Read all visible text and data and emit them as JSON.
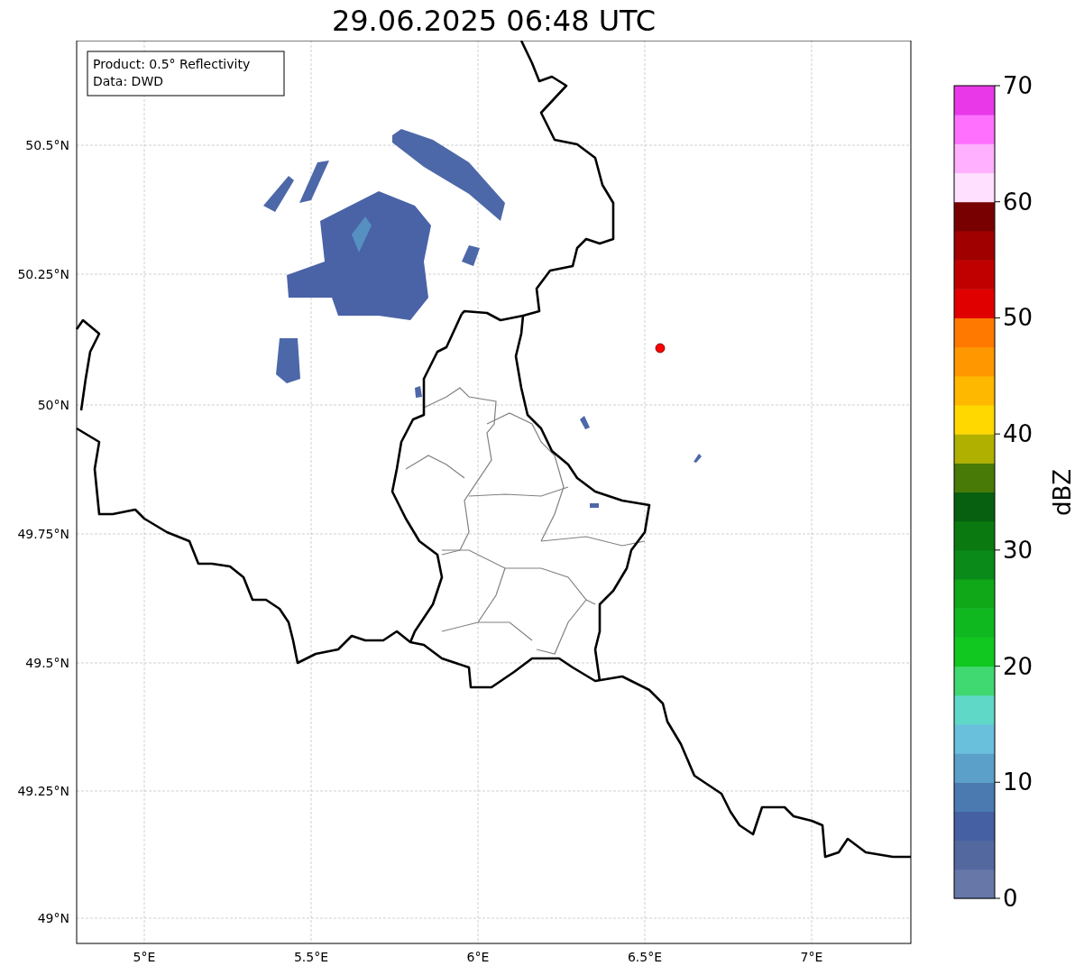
{
  "title": "29.06.2025 06:48 UTC",
  "map": {
    "info_lines": [
      "Product: 0.5° Reflectivity",
      "Data: DWD"
    ],
    "lat_labels": [
      "50.5°N",
      "50.25°N",
      "50°N",
      "49.75°N",
      "49.5°N",
      "49.25°N",
      "49°N"
    ],
    "lon_labels": [
      "5°E",
      "5.5°E",
      "6°E",
      "6.5°E",
      "7°E"
    ]
  },
  "colorbar": {
    "label": "dBZ",
    "ticks": [
      "70",
      "60",
      "50",
      "40",
      "30",
      "20",
      "10",
      "0"
    ],
    "bins": [
      {
        "color": "#6677a8"
      },
      {
        "color": "#5468a0"
      },
      {
        "color": "#4560a3"
      },
      {
        "color": "#4a7ab0"
      },
      {
        "color": "#5aa0c8"
      },
      {
        "color": "#68c0dc"
      },
      {
        "color": "#60d8c8"
      },
      {
        "color": "#40d870"
      },
      {
        "color": "#10c820"
      },
      {
        "color": "#10b820"
      },
      {
        "color": "#10a818"
      },
      {
        "color": "#0a8a18"
      },
      {
        "color": "#0a7a10"
      },
      {
        "color": "#066010"
      },
      {
        "color": "#487a08"
      },
      {
        "color": "#b0b000"
      },
      {
        "color": "#ffd800"
      },
      {
        "color": "#ffb800"
      },
      {
        "color": "#ff9800"
      },
      {
        "color": "#ff7800"
      },
      {
        "color": "#e00000"
      },
      {
        "color": "#c00000"
      },
      {
        "color": "#a00000"
      },
      {
        "color": "#780000"
      },
      {
        "color": "#ffe0ff"
      },
      {
        "color": "#ffb0ff"
      },
      {
        "color": "#ff70ff"
      },
      {
        "color": "#e838e8"
      }
    ]
  }
}
